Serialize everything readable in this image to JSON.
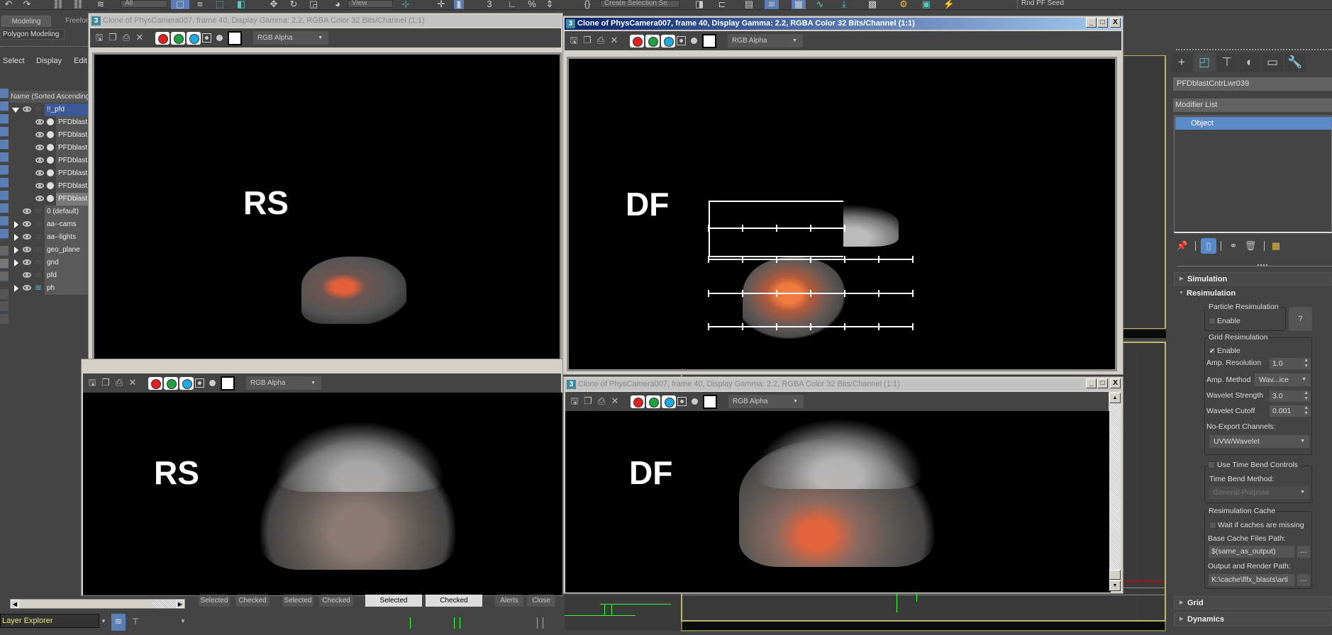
{
  "toolbar": {
    "selection_filter": "All",
    "view_dropdown": "View",
    "create_selection_set": "Create Selection Se",
    "rnd_seed_label": "Rnd PF Seed",
    "icons": [
      "undo-icon",
      "redo-icon",
      "link-icon",
      "unlink-icon",
      "bind-spacewarp-icon",
      "select-object-icon",
      "select-by-name-icon",
      "rect-region-icon",
      "window-crossing-icon",
      "move-icon",
      "rotate-icon",
      "scale-icon",
      "place-icon",
      "pivot-icon",
      "manipulate-icon",
      "snaps-3d-icon",
      "angle-snap-icon",
      "percent-snap-icon",
      "spinner-snap-icon",
      "edit-named-sets-icon",
      "mirror-icon",
      "align-icon",
      "toggle-scene-explorer-icon",
      "toggle-layer-explorer-icon",
      "toggle-ribbon-icon",
      "curve-editor-icon",
      "schematic-view-icon",
      "material-editor-icon",
      "render-setup-icon",
      "rendered-frame-icon",
      "render-icon"
    ]
  },
  "ribbon": {
    "tabs": [
      "Modeling",
      "Freeform"
    ],
    "active_tab": "Modeling",
    "subpanel": "Polygon Modeling"
  },
  "scene_explorer": {
    "menu": [
      "Select",
      "Display",
      "Edit"
    ],
    "column_header": "Name (Sorted Ascending)",
    "tree": [
      {
        "label": "!!_pfd",
        "level": 0,
        "expand": "down",
        "type": "layer",
        "selected": true
      },
      {
        "label": "PFDblast",
        "level": 1,
        "type": "object"
      },
      {
        "label": "PFDblast",
        "level": 1,
        "type": "object"
      },
      {
        "label": "PFDblast",
        "level": 1,
        "type": "object"
      },
      {
        "label": "PFDblast",
        "level": 1,
        "type": "object"
      },
      {
        "label": "PFDblast",
        "level": 1,
        "type": "object"
      },
      {
        "label": "PFDblast",
        "level": 1,
        "type": "object"
      },
      {
        "label": "PFDblast",
        "level": 1,
        "type": "object",
        "highlighted": true
      },
      {
        "label": "0 (default)",
        "level": 0,
        "expand": "none",
        "type": "layer"
      },
      {
        "label": "aa--cams",
        "level": 0,
        "expand": "right",
        "type": "layer"
      },
      {
        "label": "aa--lights",
        "level": 0,
        "expand": "right",
        "type": "layer"
      },
      {
        "label": "geo_plane",
        "level": 0,
        "expand": "right",
        "type": "layer"
      },
      {
        "label": "gnd",
        "level": 0,
        "expand": "right",
        "type": "layer"
      },
      {
        "label": "pfd",
        "level": 0,
        "expand": "none",
        "type": "layer"
      },
      {
        "label": "ph",
        "level": 0,
        "expand": "right",
        "type": "layer-current"
      }
    ],
    "layer_explorer_label": "Layer Explorer"
  },
  "frame_buffers": [
    {
      "title": "Clone of PhysCamera007, frame 40, Display Gamma: 2.2, RGBA Color 32 Bits/Channel (1:1)",
      "channel": "RGB Alpha",
      "label": "RS",
      "active": false
    },
    {
      "title": "Clone of PhysCamera007, frame 40, Display Gamma: 2.2, RGBA Color 32 Bits/Channel (1:1)",
      "channel": "RGB Alpha",
      "label": "DF",
      "active": true
    },
    {
      "title": "",
      "channel": "RGB Alpha",
      "label": "RS",
      "active": false
    },
    {
      "title": "Clone of PhysCamera007, frame 40, Display Gamma: 2.2, RGBA Color 32 Bits/Channel (1:1)",
      "channel": "RGB Alpha",
      "label": "DF",
      "active": false
    }
  ],
  "window_controls": {
    "minimize": "_",
    "maximize": "□",
    "close": "X",
    "app_icon": "3"
  },
  "vfb_bottom_buttons": [
    "Selected",
    "Checked",
    "Selected",
    "Checked",
    "Selected",
    "Checked",
    "Alerts",
    "Close"
  ],
  "command_panel": {
    "tabs": [
      "create-icon",
      "modify-icon",
      "hierarchy-icon",
      "motion-icon",
      "display-icon",
      "utilities-icon"
    ],
    "tab_glyphs": [
      "+",
      "◰",
      "⊤",
      "◐",
      "▭",
      "🔧"
    ],
    "object_name": "PFDblastCntrLwr039",
    "modifier_list_label": "Modifier List",
    "stack": [
      "Object"
    ],
    "rollouts": {
      "simulation": "Simulation",
      "resimulation": "Resimulation",
      "grid": "Grid",
      "dynamics": "Dynamics"
    },
    "particle_resim": {
      "title": "Particle Resimulation",
      "enable_label": "Enable",
      "enabled": false,
      "help": "?"
    },
    "grid_resim": {
      "title": "Grid Resimulation",
      "enable_label": "Enable",
      "enabled": true,
      "amp_resolution_label": "Amp. Resolution",
      "amp_resolution": "1.0",
      "amp_method_label": "Amp. Method",
      "amp_method": "Wav...ice",
      "wavelet_strength_label": "Wavelet Strength",
      "wavelet_strength": "3.0",
      "wavelet_cutoff_label": "Wavelet Cutoff",
      "wavelet_cutoff": "0.001",
      "no_export_label": "No-Export Channels:",
      "no_export": "UVW/Wavelet"
    },
    "time_bend": {
      "title": "Use Time Bend Controls",
      "enabled": false,
      "method_label": "Time Bend Method:",
      "method": "General-Purpose"
    },
    "resim_cache": {
      "title": "Resimulation Cache",
      "wait_label": "Wait if caches are missing",
      "wait": false,
      "base_path_label": "Base Cache Files Path:",
      "base_path": "$(same_as_output)",
      "output_path_label": "Output and Render Path:",
      "output_path": "K:\\cache\\flfx_blasts\\arti",
      "browse": "..."
    }
  },
  "colors": {
    "ui_bg": "#444444",
    "selection_blue": "#5b8ac9",
    "viewport_border": "#c0b76e",
    "titlebar_active": "#0a246a",
    "accent_cyan": "#4bc2c2"
  }
}
